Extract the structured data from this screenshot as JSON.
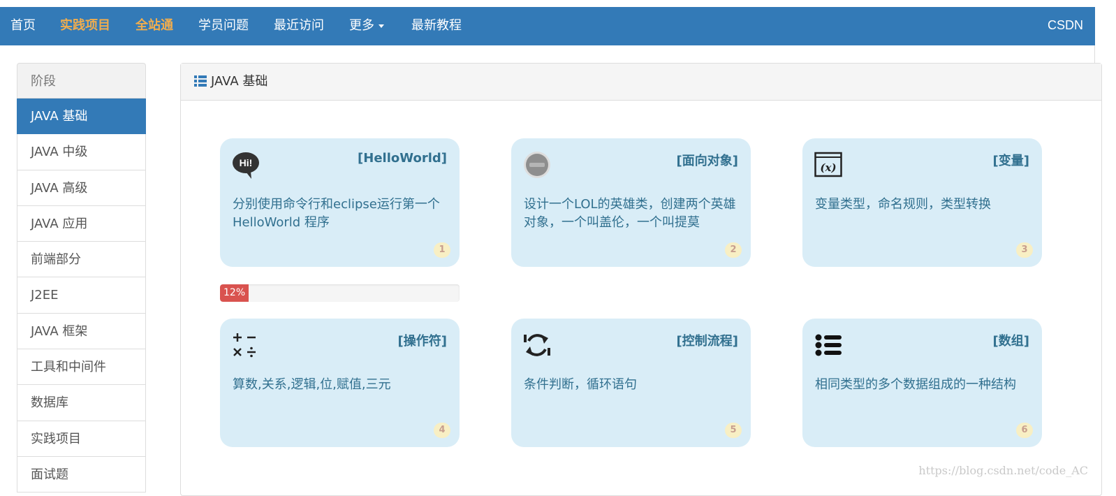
{
  "nav": {
    "items": [
      {
        "label": "首页",
        "highlight": false
      },
      {
        "label": "实践项目",
        "highlight": true
      },
      {
        "label": "全站通",
        "highlight": true
      },
      {
        "label": "学员问题",
        "highlight": false
      },
      {
        "label": "最近访问",
        "highlight": false
      },
      {
        "label": "更多",
        "highlight": false
      },
      {
        "label": "最新教程",
        "highlight": false
      }
    ],
    "brand": "CSDN",
    "bg_color": "#337ab7",
    "highlight_color": "#f0ad4e"
  },
  "sidebar": {
    "header": "阶段",
    "items": [
      {
        "label": "JAVA 基础",
        "active": true
      },
      {
        "label": "JAVA 中级",
        "active": false
      },
      {
        "label": "JAVA 高级",
        "active": false
      },
      {
        "label": "JAVA 应用",
        "active": false
      },
      {
        "label": "前端部分",
        "active": false
      },
      {
        "label": "J2EE",
        "active": false
      },
      {
        "label": "JAVA 框架",
        "active": false
      },
      {
        "label": "工具和中间件",
        "active": false
      },
      {
        "label": "数据库",
        "active": false
      },
      {
        "label": "实践项目",
        "active": false
      },
      {
        "label": "面试题",
        "active": false
      }
    ]
  },
  "panel": {
    "title": "JAVA 基础",
    "title_icon": "list-icon"
  },
  "cards": [
    {
      "title": "[HelloWorld]",
      "desc": "分别使用命令行和eclipse运行第一个HelloWorld 程序",
      "num": "1",
      "icon": "hi-speech-bubble-icon"
    },
    {
      "title": "[面向对象]",
      "desc": "设计一个LOL的英雄类，创建两个英雄对象，一个叫盖伦，一个叫提莫",
      "num": "2",
      "icon": "lol-logo-icon"
    },
    {
      "title": "[变量]",
      "desc": "变量类型，命名规则，类型转换",
      "num": "3",
      "icon": "variable-x-icon"
    },
    {
      "title": "[操作符]",
      "desc": "算数,关系,逻辑,位,赋值,三元",
      "num": "4",
      "icon": "math-operators-icon"
    },
    {
      "title": "[控制流程]",
      "desc": "条件判断，循环语句",
      "num": "5",
      "icon": "refresh-loop-icon"
    },
    {
      "title": "[数组]",
      "desc": "相同类型的多个数据组成的一种结构",
      "num": "6",
      "icon": "list-bullets-icon"
    }
  ],
  "progress": {
    "label": "12%",
    "value": 0.12,
    "color": "#d9534f"
  },
  "watermark": "https://blog.csdn.net/code_AC"
}
